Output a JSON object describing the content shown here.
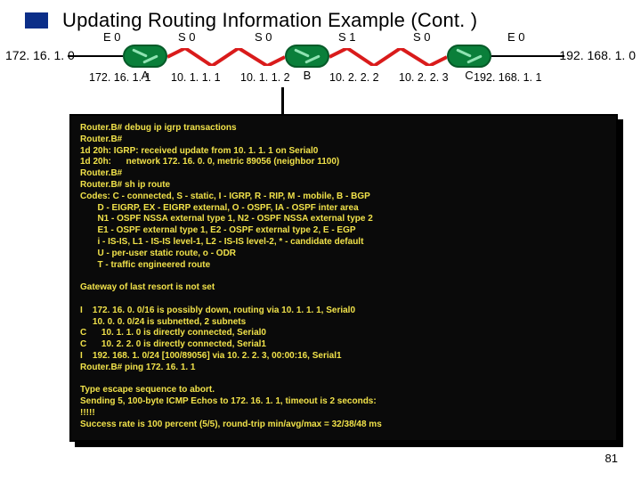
{
  "title": "Updating Routing Information Example (Cont. )",
  "page_number": "81",
  "diagram": {
    "left_network": "172. 16. 1. 0",
    "right_network": "192. 168. 1. 0",
    "interfaces": {
      "A_e0": "E 0",
      "A_s0": "S 0",
      "B_s0": "S 0",
      "B_s1": "S 1",
      "C_s0": "S 0",
      "C_e0": "E 0"
    },
    "router_labels": {
      "A": "A",
      "B": "B",
      "C": "C"
    },
    "addresses": {
      "A_e0": "172. 16. 1. 1",
      "A_s0": "10. 1. 1. 1",
      "B_s0": "10. 1. 1. 2",
      "B_s1": "10. 2. 2. 2",
      "C_s0": "10. 2. 2. 3",
      "C_e0": "192. 168. 1. 1"
    }
  },
  "terminal_lines": [
    "Router.B# debug ip igrp transactions",
    "Router.B#",
    "1d 20h: IGRP: received update from 10. 1. 1. 1 on Serial0",
    "1d 20h:      network 172. 16. 0. 0, metric 89056 (neighbor 1100)",
    "Router.B#",
    "Router.B# sh ip route",
    "Codes: C - connected, S - static, I - IGRP, R - RIP, M - mobile, B - BGP",
    "       D - EIGRP, EX - EIGRP external, O - OSPF, IA - OSPF inter area",
    "       N1 - OSPF NSSA external type 1, N2 - OSPF NSSA external type 2",
    "       E1 - OSPF external type 1, E2 - OSPF external type 2, E - EGP",
    "       i - IS-IS, L1 - IS-IS level-1, L2 - IS-IS level-2, * - candidate default",
    "       U - per-user static route, o - ODR",
    "       T - traffic engineered route",
    "",
    "Gateway of last resort is not set",
    "",
    "I    172. 16. 0. 0/16 is possibly down, routing via 10. 1. 1. 1, Serial0",
    "     10. 0. 0. 0/24 is subnetted, 2 subnets",
    "C      10. 1. 1. 0 is directly connected, Serial0",
    "C      10. 2. 2. 0 is directly connected, Serial1",
    "I    192. 168. 1. 0/24 [100/89056] via 10. 2. 2. 3, 00:00:16, Serial1",
    "Router.B# ping 172. 16. 1. 1",
    "",
    "Type escape sequence to abort.",
    "Sending 5, 100-byte ICMP Echos to 172. 16. 1. 1, timeout is 2 seconds:",
    "!!!!!",
    "Success rate is 100 percent (5/5), round-trip min/avg/max = 32/38/48 ms"
  ]
}
